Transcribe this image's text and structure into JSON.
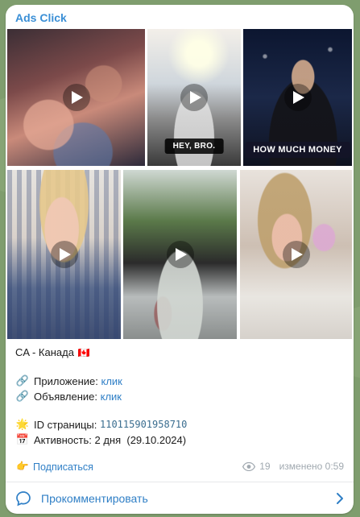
{
  "channel": {
    "name": "Ads Click"
  },
  "media": [
    {
      "kind": "video",
      "caption": "",
      "icon": "play-icon"
    },
    {
      "kind": "video",
      "caption": "HEY, BRO.",
      "icon": "play-icon"
    },
    {
      "kind": "video",
      "caption": "HOW MUCH MONEY",
      "icon": "play-icon"
    },
    {
      "kind": "video",
      "caption": "",
      "icon": "play-icon"
    },
    {
      "kind": "video",
      "caption": "",
      "icon": "play-icon"
    },
    {
      "kind": "video",
      "caption": "",
      "icon": "play-icon"
    }
  ],
  "post": {
    "geo": "CA - Канада",
    "geo_flag": "🇨🇦",
    "app_label": "Приложение:",
    "app_link": "клик",
    "ad_label": "Объявление:",
    "ad_link": "клик",
    "page_id_label": "ID страницы:",
    "page_id": "110115901958710",
    "activity_label": "Активность:",
    "activity_value": "2 дня  (29.10.2024)"
  },
  "footer": {
    "subscribe": "Подписаться",
    "views": "19",
    "edited": "изменено 0:59",
    "comment": "Прокомментировать"
  },
  "colors": {
    "accent": "#2f7fc6",
    "background": "#7f9d6e"
  }
}
